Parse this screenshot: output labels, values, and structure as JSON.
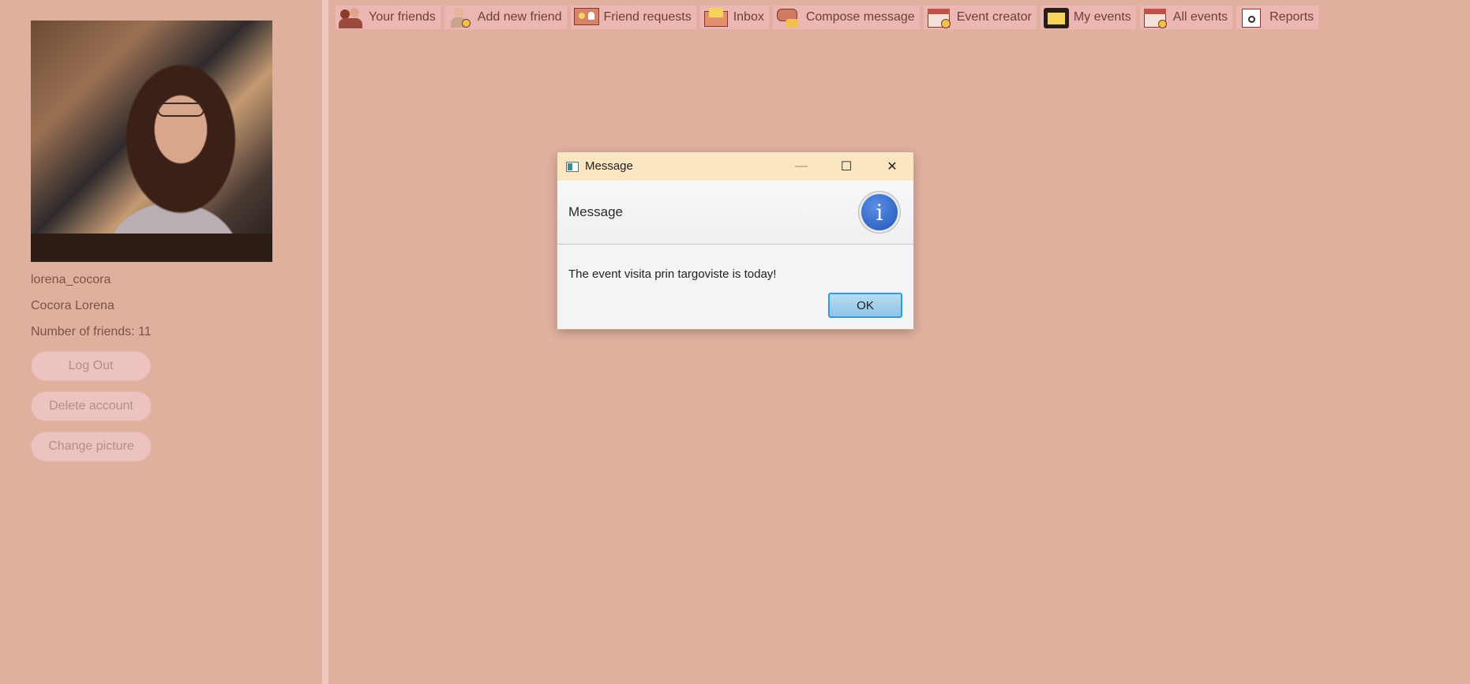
{
  "profile": {
    "username": "lorena_cocora",
    "full_name": "Cocora Lorena",
    "friends_count": "Number of friends: 11",
    "logout_label": "Log Out",
    "delete_label": "Delete account",
    "change_picture_label": "Change picture"
  },
  "toolbar": {
    "items": [
      {
        "label": "Your friends",
        "icon": "friends-icon"
      },
      {
        "label": "Add new friend",
        "icon": "add-friend-icon"
      },
      {
        "label": "Friend requests",
        "icon": "friend-requests-icon"
      },
      {
        "label": "Inbox",
        "icon": "envelope-icon"
      },
      {
        "label": "Compose message",
        "icon": "compose-icon"
      },
      {
        "label": "Event creator",
        "icon": "calendar-add-icon"
      },
      {
        "label": "My events",
        "icon": "star-calendar-icon"
      },
      {
        "label": "All events",
        "icon": "calendar-clock-icon"
      },
      {
        "label": "Reports",
        "icon": "report-icon"
      }
    ]
  },
  "dialog": {
    "title": "Message",
    "header": "Message",
    "content": "The event visita prin targoviste is today!",
    "ok_label": "OK",
    "minimize_glyph": "—",
    "maximize_glyph": "☐",
    "close_glyph": "✕",
    "info_glyph": "i"
  },
  "colors": {
    "background": "#e0b09e",
    "toolbar_button": "#ecb7b3",
    "side_button": "#ecc3c0",
    "dialog_title": "#fbe6c2",
    "ok_border": "#2f9be0"
  }
}
